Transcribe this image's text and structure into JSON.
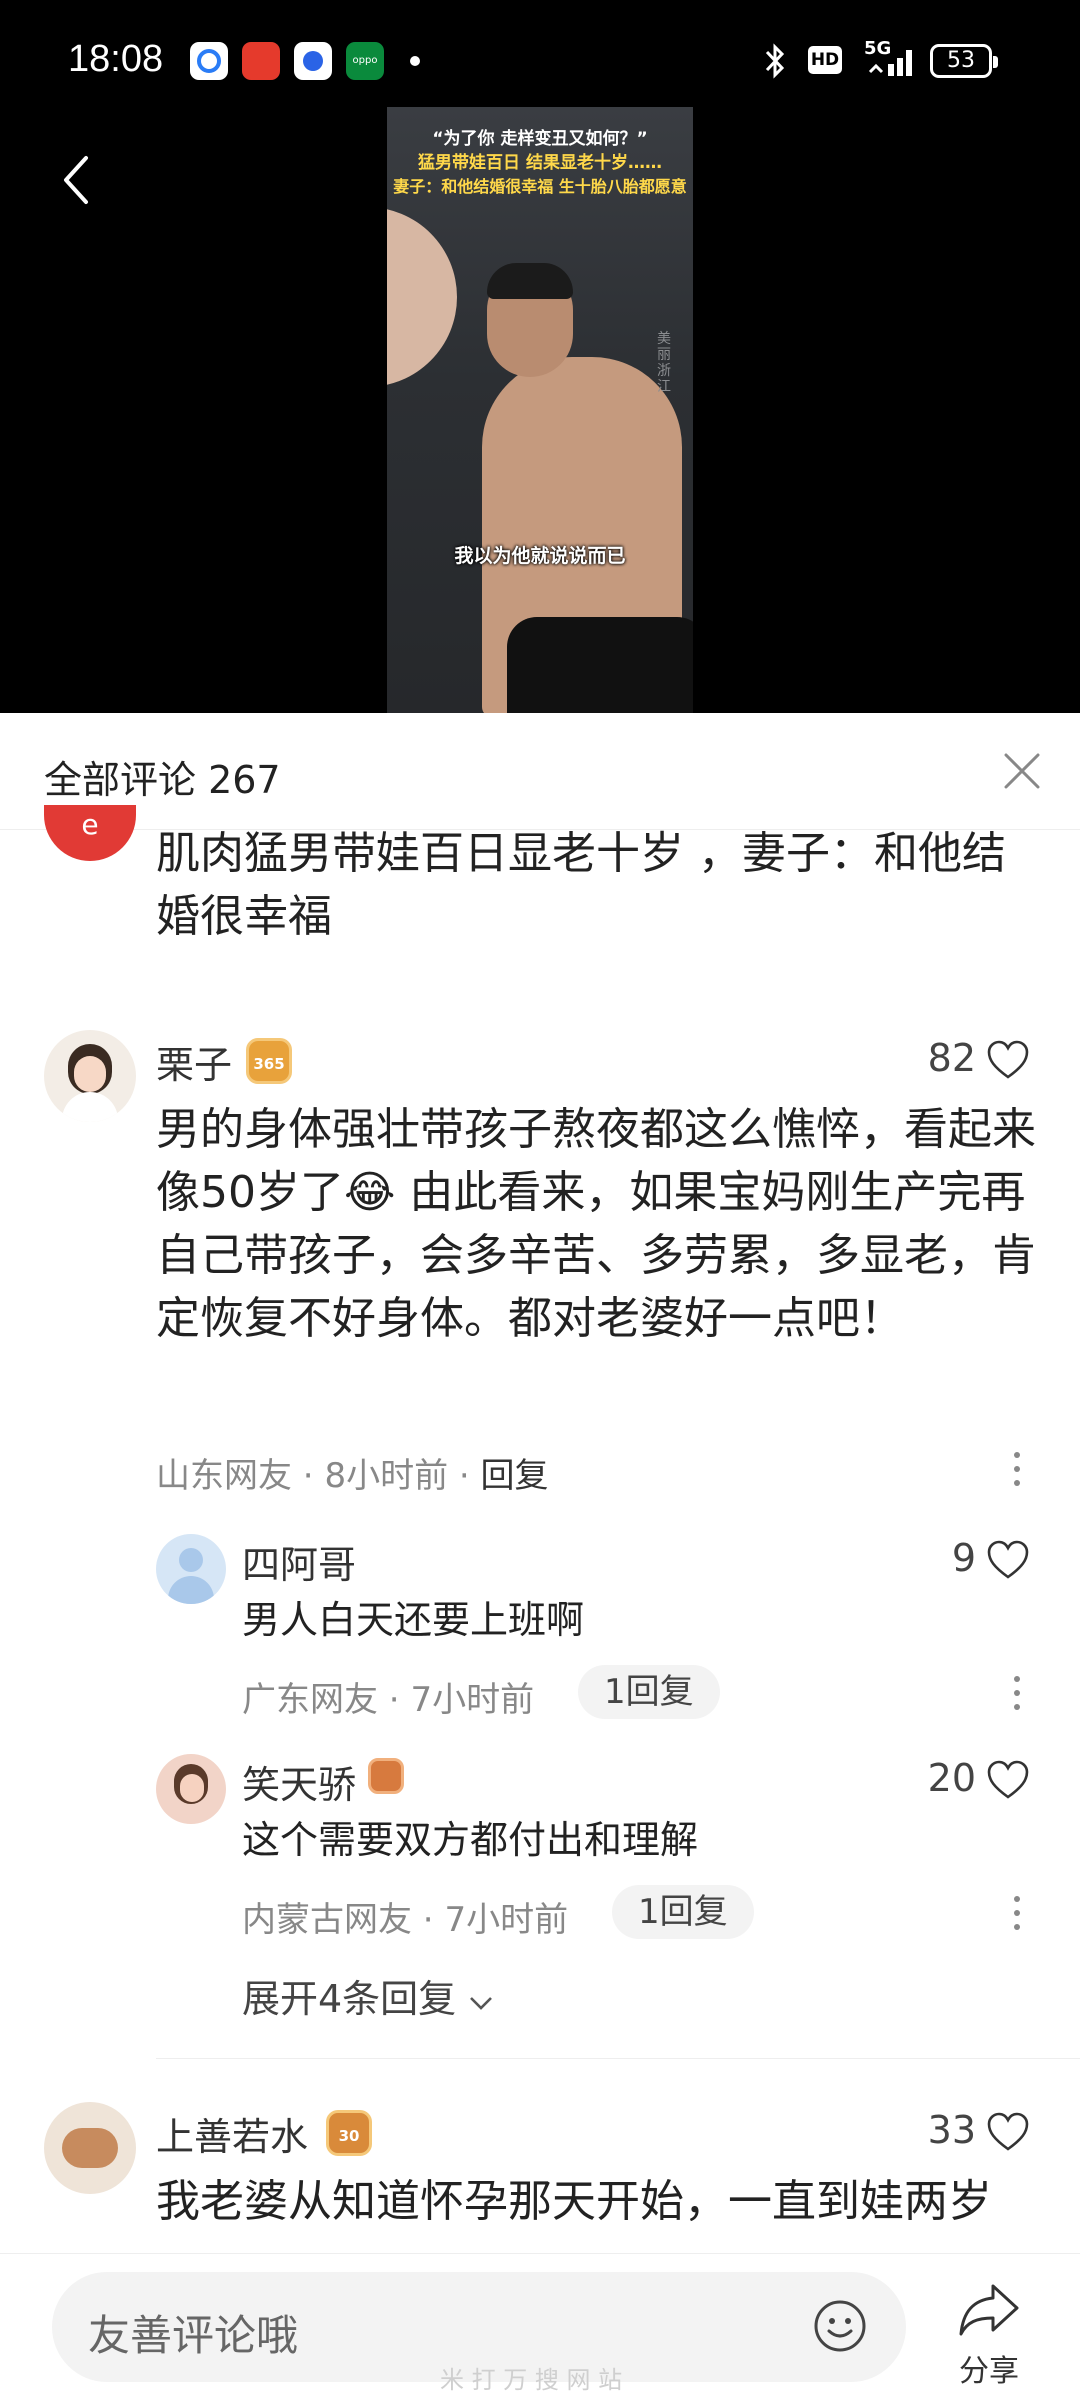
{
  "status_bar": {
    "time": "18:08",
    "network": "5G",
    "hd": "HD",
    "battery": "53"
  },
  "video": {
    "headline_line1": "“为了你 走样变丑又如何？”",
    "headline_line2": "猛男带娃百日 结果显老十岁……",
    "headline_line3": "妻子：和他结婚很幸福 生十胎八胎都愿意",
    "subtitle": "我以为他就说说而已",
    "side_mark": "美丽浙江"
  },
  "comments_panel": {
    "title": "全部评论 267",
    "post_description": "肌肉猛男带娃百日显老十岁 ，妻子：和他结婚很幸福",
    "comments": [
      {
        "name": "栗子",
        "badge": "365",
        "likes": "82",
        "text": "男的身体强壮带孩子熬夜都这么憔悴，看起来像50岁了😂 由此看来，如果宝妈刚生产完再自己带孩子，会多辛苦、多劳累，多显老，肯定恢复不好身体。都对老婆好一点吧！",
        "location": "山东网友",
        "time": "8小时前",
        "reply_label": "回复"
      },
      {
        "name": "四阿哥",
        "likes": "9",
        "text": "男人白天还要上班啊",
        "location": "广东网友",
        "time": "7小时前",
        "replies": "1回复"
      },
      {
        "name": "笑天骄",
        "likes": "20",
        "text": "这个需要双方都付出和理解",
        "location": "内蒙古网友",
        "time": "7小时前",
        "replies": "1回复"
      },
      {
        "name": "上善若水",
        "badge": "30",
        "likes": "33",
        "text": "我老婆从知道怀孕那天开始，一直到娃两岁"
      }
    ],
    "expand_label": "展开4条回复"
  },
  "bottom_bar": {
    "input_placeholder": "友善评论哦",
    "share_label": "分享"
  },
  "watermark": "米 打 万 搜 网 站"
}
